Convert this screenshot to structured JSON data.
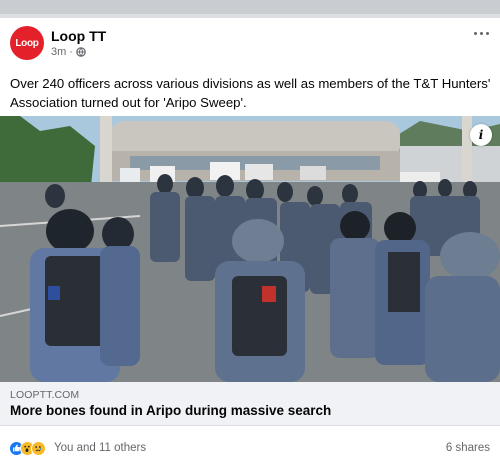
{
  "post": {
    "page_name": "Loop TT",
    "avatar_text": "Loop",
    "timestamp": "3m",
    "separator": "·",
    "caption": "Over 240 officers across various divisions as well as members of the T&T Hunters' Association turned out for 'Aripo Sweep'."
  },
  "photo": {
    "info_label": "i"
  },
  "link": {
    "domain": "LOOPTT.COM",
    "headline": "More bones found in Aripo during massive search"
  },
  "footer": {
    "reactions_text": "You and 11 others",
    "shares_text": "6 shares",
    "reaction_icons": [
      "like-icon",
      "wow-icon",
      "sad-icon"
    ]
  },
  "colors": {
    "brand_red": "#e4202b",
    "link_bar": "#f0f2f5",
    "meta_gray": "#65676b",
    "like_blue": "#1877f2"
  }
}
